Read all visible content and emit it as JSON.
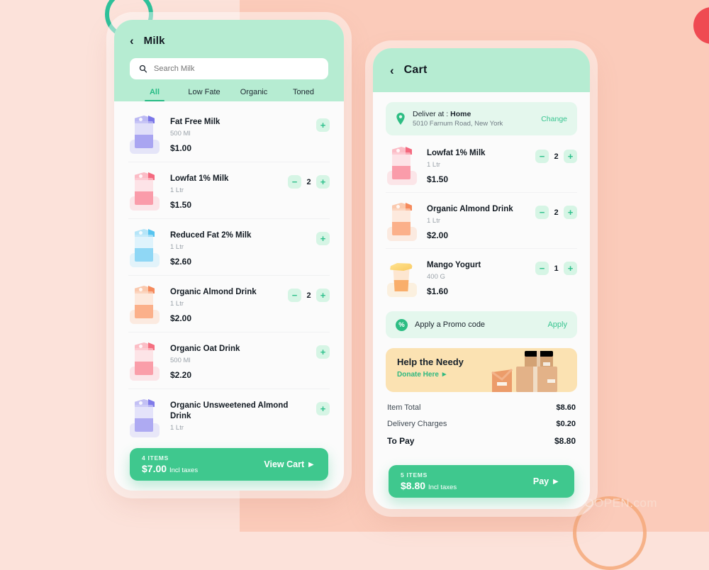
{
  "theme": {
    "bg_left": "#FCE2DA",
    "bg_right": "#FBCBBA",
    "mint_header": "#B6ECD2",
    "accent_green": "#3FC88E",
    "soft_green": "#D6F5E5",
    "donate_bg": "#FBE2B2"
  },
  "decor": {
    "watermark": "TOOOPEN.com"
  },
  "catalog": {
    "header": {
      "back_icon": "chevron-left-icon",
      "title": "Milk"
    },
    "search": {
      "icon": "search-icon",
      "placeholder": "Search Milk",
      "value": ""
    },
    "tabs": [
      {
        "label": "All",
        "active": true
      },
      {
        "label": "Low Fate",
        "active": false
      },
      {
        "label": "Organic",
        "active": false
      },
      {
        "label": "Toned",
        "active": false
      }
    ],
    "products": [
      {
        "name": "Fat Free Milk",
        "size": "500 Ml",
        "price": "$1.00",
        "qty": null,
        "add_label": "+",
        "color": "#8f8ef0",
        "type": "carton"
      },
      {
        "name": "Lowfat 1% Milk",
        "size": "1 Ltr",
        "price": "$1.50",
        "qty": "2",
        "add_label": "+",
        "minus_label": "−",
        "color": "#f8889a",
        "type": "carton"
      },
      {
        "name": "Reduced Fat 2% Milk",
        "size": "1 Ltr",
        "price": "$2.60",
        "qty": null,
        "add_label": "+",
        "color": "#6fd0f5",
        "type": "carton"
      },
      {
        "name": "Organic Almond Drink",
        "size": "1 Ltr",
        "price": "$2.00",
        "qty": "2",
        "add_label": "+",
        "minus_label": "−",
        "color": "#f79a6e",
        "type": "carton"
      },
      {
        "name": "Organic Oat Drink",
        "size": "500 Ml",
        "price": "$2.20",
        "qty": null,
        "add_label": "+",
        "color": "#f5899a",
        "type": "carton"
      },
      {
        "name": "Organic Unsweetened Almond Drink",
        "size": "1 Ltr",
        "price": "",
        "qty": null,
        "add_label": "+",
        "color": "#9a95ef",
        "type": "carton"
      }
    ],
    "cart_bar": {
      "items": "4 ITEMS",
      "total": "$7.00",
      "tax_note": "Incl taxes",
      "cta": "View Cart",
      "cta_icon": "play-triangle-icon"
    }
  },
  "cart": {
    "header": {
      "back_icon": "chevron-left-icon",
      "title": "Cart"
    },
    "address": {
      "pin_icon": "location-pin-icon",
      "label_prefix": "Deliver at : ",
      "label_value": "Home",
      "line2": "5010  Farnum Road, New York",
      "change": "Change"
    },
    "items": [
      {
        "name": "Lowfat 1% Milk",
        "size": "1 Ltr",
        "price": "$1.50",
        "qty": "2",
        "minus_label": "−",
        "plus_label": "+",
        "color": "#f8889a",
        "type": "carton"
      },
      {
        "name": "Organic Almond Drink",
        "size": "1 Ltr",
        "price": "$2.00",
        "qty": "2",
        "minus_label": "−",
        "plus_label": "+",
        "color": "#f79a6e",
        "type": "carton"
      },
      {
        "name": "Mango Yogurt",
        "size": "400 G",
        "price": "$1.60",
        "qty": "1",
        "minus_label": "−",
        "plus_label": "+",
        "color": "#f6a55e",
        "type": "cup"
      }
    ],
    "promo": {
      "icon": "percent-icon",
      "text": "Apply a Promo code",
      "action": "Apply"
    },
    "donate": {
      "title": "Help the Needy",
      "link": "Donate Here",
      "link_icon": "play-triangle-icon",
      "art": "cardboard-boxes-illustration"
    },
    "totals": [
      {
        "label": "Item Total",
        "value": "$8.60",
        "strong": false
      },
      {
        "label": "Delivery Charges",
        "value": "$0.20",
        "strong": false
      },
      {
        "label": "To Pay",
        "value": "$8.80",
        "strong": true
      }
    ],
    "pay_bar": {
      "items": "5 ITEMS",
      "total": "$8.80",
      "tax_note": "Incl taxes",
      "cta": "Pay",
      "cta_icon": "play-triangle-icon"
    }
  }
}
